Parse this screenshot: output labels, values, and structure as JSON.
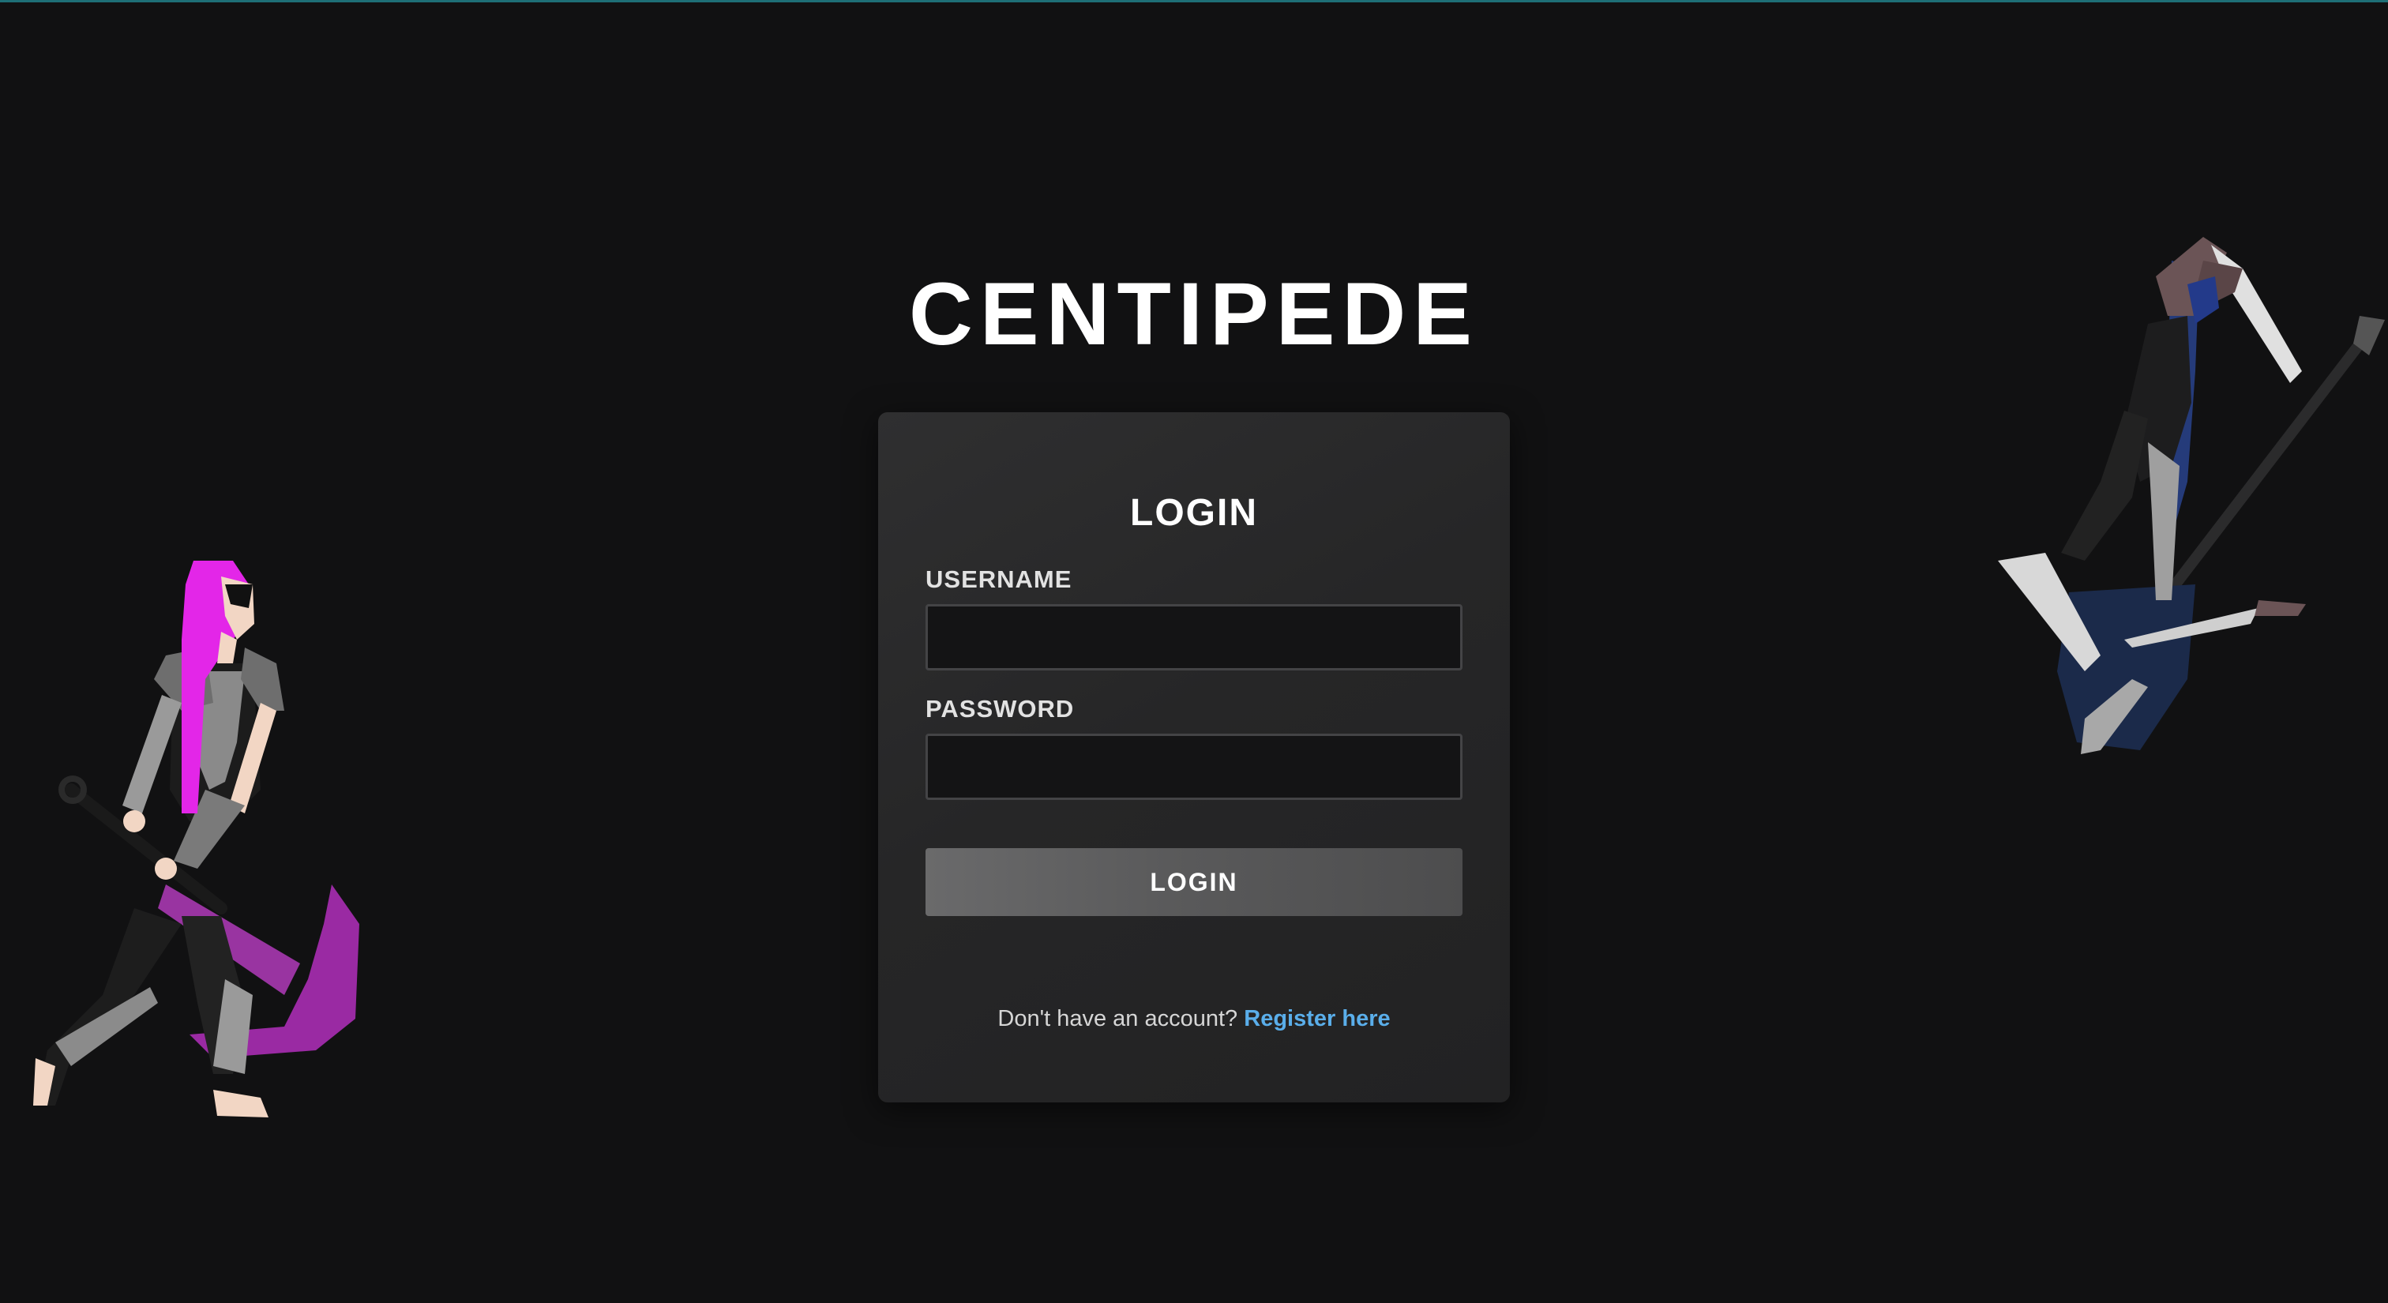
{
  "page": {
    "title": "CENTIPEDE"
  },
  "login_card": {
    "heading": "LOGIN",
    "username": {
      "label": "USERNAME",
      "value": "",
      "placeholder": ""
    },
    "password": {
      "label": "PASSWORD",
      "value": "",
      "placeholder": ""
    },
    "submit_label": "LOGIN",
    "register_prompt": "Don't have an account?",
    "register_link": "Register here"
  },
  "illustrations": {
    "left": "warrior-with-scythe-illustration",
    "right": "warrior-with-spear-illustration"
  },
  "colors": {
    "background": "#111112",
    "card": "#2a2a2b",
    "accent_link": "#5aaeea",
    "button": "#5e5e5f",
    "top_line": "#1e6f76"
  }
}
